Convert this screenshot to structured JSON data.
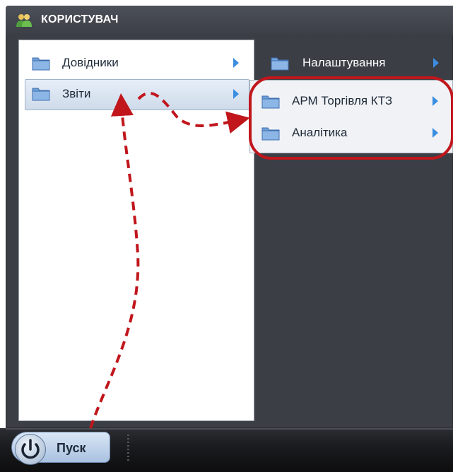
{
  "window": {
    "title": "КОРИСТУВАЧ",
    "title_icon": "users-icon"
  },
  "menu": {
    "items": [
      {
        "label": "Довідники",
        "icon": "folder-icon",
        "has_submenu": true,
        "selected": false
      },
      {
        "label": "Звіти",
        "icon": "folder-icon",
        "has_submenu": true,
        "selected": true
      }
    ]
  },
  "side_menu": {
    "items": [
      {
        "label": "Налаштування",
        "icon": "folder-icon",
        "has_submenu": true
      }
    ]
  },
  "submenu": {
    "items": [
      {
        "label": "АРМ Торгівля КТЗ",
        "icon": "folder-icon",
        "has_submenu": true
      },
      {
        "label": "Аналітика",
        "icon": "folder-icon",
        "has_submenu": true
      }
    ]
  },
  "taskbar": {
    "start_label": "Пуск",
    "start_icon": "power-icon"
  },
  "colors": {
    "annotation": "#c0161c",
    "accent_arrow": "#3b8ee0",
    "folder": "#5b8fcf",
    "frame": "#3b3e45"
  }
}
